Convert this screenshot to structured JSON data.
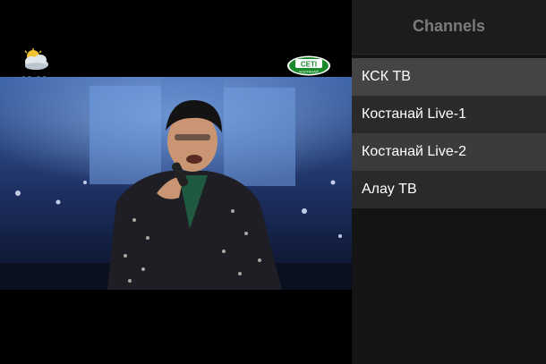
{
  "overlay": {
    "clock": "23:38",
    "weather_icon": "partly-cloudy-icon",
    "channel_logo": {
      "icon": "channel-logo-icon",
      "text": "СЕТІ",
      "sub_text": "КОСТАНАЙ"
    }
  },
  "panel": {
    "title": "Channels",
    "channels": [
      {
        "label": "КСК ТВ",
        "selected": true
      },
      {
        "label": "Костанай Live-1",
        "selected": false
      },
      {
        "label": "Костанай Live-2",
        "selected": false
      },
      {
        "label": "Алау ТВ",
        "selected": false
      }
    ]
  },
  "colors": {
    "panel_bg": "#141414",
    "panel_header_bg": "#1c1c1c",
    "panel_title": "#7b7b7b",
    "item_light": "#3b3b3b",
    "item_dark": "#2a2a2a",
    "logo_green": "#1a8a2c"
  }
}
